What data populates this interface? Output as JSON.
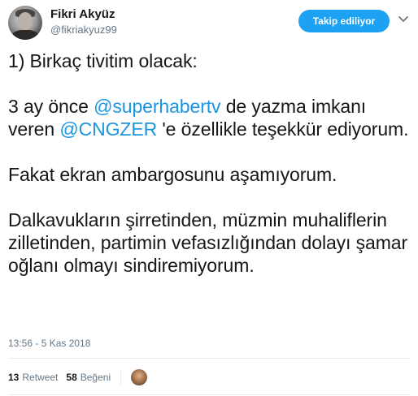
{
  "author": {
    "name": "Fikri Akyüz",
    "handle": "@fikriakyuz99",
    "avatar_icon": "profile-photo"
  },
  "follow_button": {
    "label": "Takip ediliyor"
  },
  "menu_icon": "chevron-down-icon",
  "tweet": {
    "line1": "1) Birkaç tivitim olacak:",
    "p2_part1": "3 ay önce ",
    "mention1": "@superhabertv",
    "p2_part2": " de yazma imkanı veren ",
    "mention2": "@CNGZER",
    "p2_part3": " 'e özellikle teşekkür ediyorum.",
    "p3": "Fakat ekran ambargosunu aşamıyorum.",
    "p4": "Dalkavukların şirretinden, müzmin muhaliflerin zilletinden, partimin vefasızlığından dolayı şamar oğlanı olmayı sindiremiyorum."
  },
  "timestamp": "13:56 - 5 Kas 2018",
  "stats": {
    "retweets_count": "13",
    "retweets_label": "Retweet",
    "likes_count": "58",
    "likes_label": "Beğeni"
  },
  "colors": {
    "accent": "#1da1f2",
    "mention": "#1b95e0",
    "secondary_text": "#657786",
    "divider": "#e6ecf0"
  }
}
